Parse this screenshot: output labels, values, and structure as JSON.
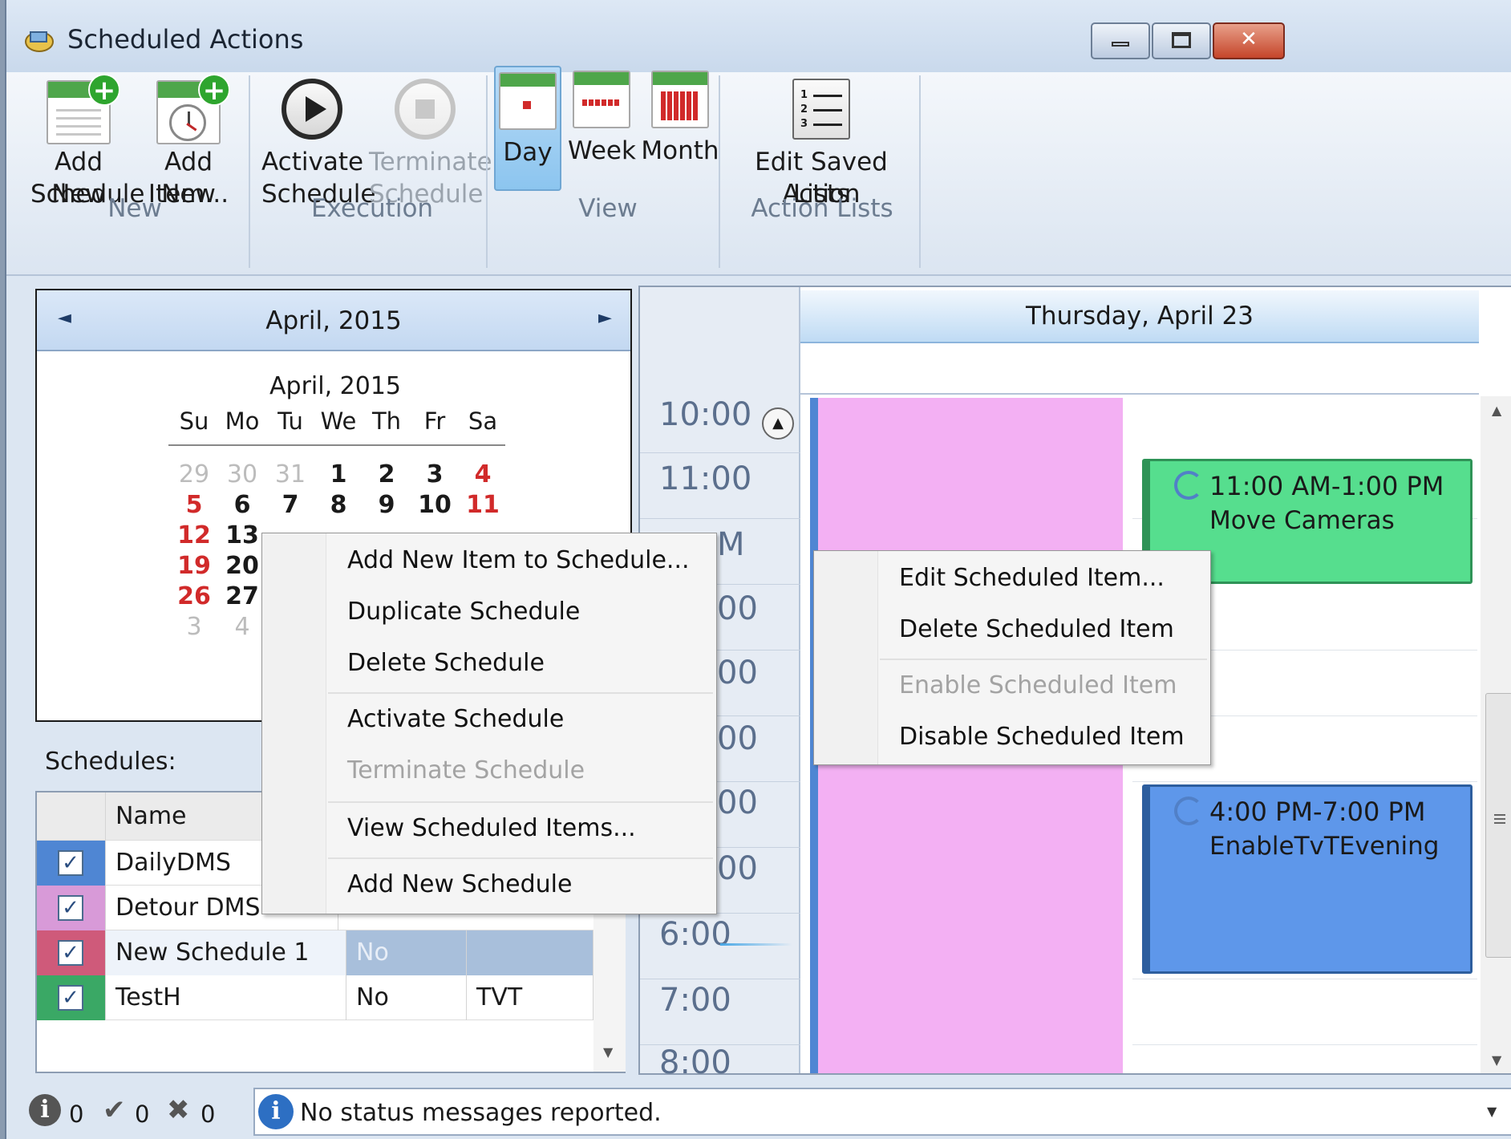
{
  "window": {
    "title": "Scheduled Actions",
    "controls": {
      "minimize": "▭",
      "maximize": "□",
      "close": "✕"
    }
  },
  "ribbon": {
    "groups": [
      {
        "label": "New",
        "buttons": [
          {
            "label": "Add New Schedule",
            "icon": "add-schedule-icon"
          },
          {
            "label": "Add New Item...",
            "icon": "add-item-icon"
          }
        ]
      },
      {
        "label": "Execution",
        "buttons": [
          {
            "label": "Activate Schedule",
            "icon": "play-icon"
          },
          {
            "label": "Terminate Schedule",
            "icon": "stop-icon",
            "disabled": true
          }
        ]
      },
      {
        "label": "View",
        "buttons": [
          {
            "label": "Day",
            "icon": "day-calendar-icon",
            "selected": true
          },
          {
            "label": "Week",
            "icon": "week-calendar-icon"
          },
          {
            "label": "Month",
            "icon": "month-calendar-icon"
          }
        ]
      },
      {
        "label": "Action Lists",
        "buttons": [
          {
            "label": "Edit Saved Action Lists",
            "icon": "numbered-list-icon"
          }
        ]
      }
    ],
    "b_add_schedule_1": "Add New",
    "b_add_schedule_2": "Schedule",
    "b_add_item_1": "Add New",
    "b_add_item_2": "Item...",
    "b_activate_1": "Activate",
    "b_activate_2": "Schedule",
    "b_terminate_1": "Terminate",
    "b_terminate_2": "Schedule",
    "b_day": "Day",
    "b_week": "Week",
    "b_month": "Month",
    "b_edit_lists_1": "Edit Saved Action",
    "b_edit_lists_2": "Lists",
    "g_new": "New",
    "g_execution": "Execution",
    "g_view": "View",
    "g_action_lists": "Action Lists"
  },
  "mini_calendar": {
    "header": "April, 2015",
    "subheader": "April, 2015",
    "prev_arrow": "◄",
    "next_arrow": "►",
    "days_of_week": [
      "Su",
      "Mo",
      "Tu",
      "We",
      "Th",
      "Fr",
      "Sa"
    ],
    "weeks": [
      [
        "29",
        "30",
        "31",
        "1",
        "2",
        "3",
        "4"
      ],
      [
        "5",
        "6",
        "7",
        "8",
        "9",
        "10",
        "11"
      ],
      [
        "12",
        "13",
        "",
        "",
        "",
        "",
        ""
      ],
      [
        "19",
        "20",
        "",
        "",
        "",
        "",
        ""
      ],
      [
        "26",
        "27",
        "",
        "",
        "",
        "",
        ""
      ],
      [
        "3",
        "4",
        "",
        "",
        "",
        "",
        ""
      ]
    ]
  },
  "schedules": {
    "label": "Schedules:",
    "column_name": "Name",
    "colors": {
      "DailyDMS": "#4f86d3",
      "Detour DMS": "#d89ad8",
      "New Schedule 1": "#cf5a7a",
      "TestH": "#3aa865"
    },
    "rows": [
      {
        "name": "DailyDMS",
        "active": "",
        "type": ""
      },
      {
        "name": "Detour DMS",
        "active": "",
        "type": ""
      },
      {
        "name": "New Schedule 1",
        "active": "No",
        "type": ""
      },
      {
        "name": "TestH",
        "active": "No",
        "type": "TVT"
      }
    ]
  },
  "day_view": {
    "date_header": "Thursday, April 23",
    "hours": [
      "10:00",
      "11:00",
      "M",
      "00",
      "00",
      "00",
      "00",
      "00",
      "6:00",
      "7:00",
      "8:00"
    ],
    "appointments": [
      {
        "time": "11:00 AM-1:00 PM",
        "name": "Move Cameras",
        "color": "#56de8e"
      },
      {
        "time": "4:00 PM-7:00 PM",
        "name": "EnableTvTEvening",
        "color": "#5e97ea"
      }
    ]
  },
  "context_menu_schedule": {
    "items": [
      "Add New Item to Schedule...",
      "Duplicate Schedule",
      "Delete Schedule",
      "Activate Schedule",
      "Terminate Schedule",
      "View Scheduled Items...",
      "Add New Schedule"
    ]
  },
  "context_menu_item": {
    "items": [
      "Edit Scheduled Item...",
      "Delete Scheduled Item",
      "Enable Scheduled Item",
      "Disable Scheduled Item"
    ]
  },
  "status_bar": {
    "info_count": "0",
    "ok_count": "0",
    "error_count": "0",
    "message": "No status messages reported.",
    "info_glyph": "i"
  }
}
